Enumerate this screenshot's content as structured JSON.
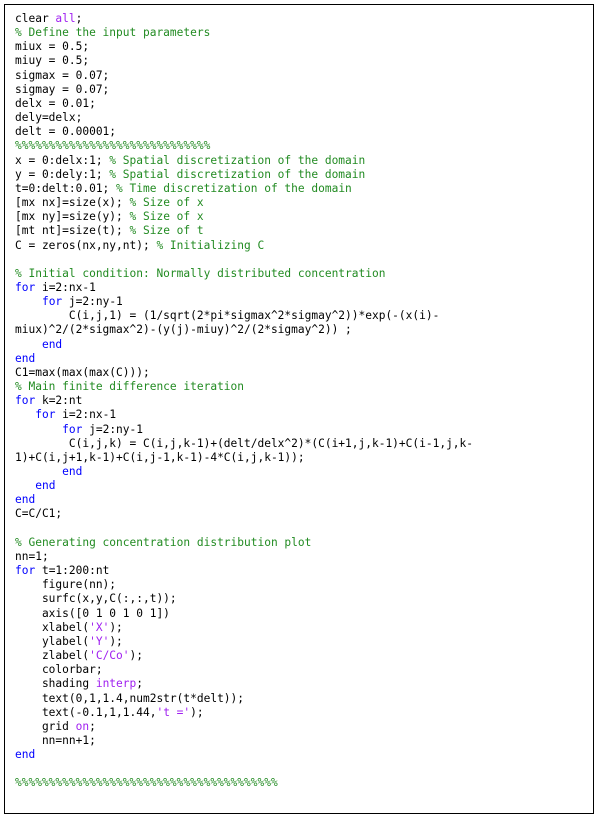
{
  "code": {
    "lines": [
      [
        {
          "t": "pl",
          "v": "clear "
        },
        {
          "t": "str",
          "v": "all"
        },
        {
          "t": "pl",
          "v": ";"
        }
      ],
      [
        {
          "t": "cm",
          "v": "% Define the input parameters"
        }
      ],
      [
        {
          "t": "pl",
          "v": "miux = 0.5;"
        }
      ],
      [
        {
          "t": "pl",
          "v": "miuy = 0.5;"
        }
      ],
      [
        {
          "t": "pl",
          "v": "sigmax = 0.07;"
        }
      ],
      [
        {
          "t": "pl",
          "v": "sigmay = 0.07;"
        }
      ],
      [
        {
          "t": "pl",
          "v": "delx = 0.01;"
        }
      ],
      [
        {
          "t": "pl",
          "v": "dely=delx;"
        }
      ],
      [
        {
          "t": "pl",
          "v": "delt = 0.00001;"
        }
      ],
      [
        {
          "t": "cm",
          "v": "%%%%%%%%%%%%%%%%%%%%%%%%%%%%%"
        }
      ],
      [
        {
          "t": "pl",
          "v": "x = 0:delx:1; "
        },
        {
          "t": "cm",
          "v": "% Spatial discretization of the domain"
        }
      ],
      [
        {
          "t": "pl",
          "v": "y = 0:dely:1; "
        },
        {
          "t": "cm",
          "v": "% Spatial discretization of the domain"
        }
      ],
      [
        {
          "t": "pl",
          "v": "t=0:delt:0.01; "
        },
        {
          "t": "cm",
          "v": "% Time discretization of the domain"
        }
      ],
      [
        {
          "t": "pl",
          "v": "[mx nx]=size(x); "
        },
        {
          "t": "cm",
          "v": "% Size of x"
        }
      ],
      [
        {
          "t": "pl",
          "v": "[mx ny]=size(y); "
        },
        {
          "t": "cm",
          "v": "% Size of x"
        }
      ],
      [
        {
          "t": "pl",
          "v": "[mt nt]=size(t); "
        },
        {
          "t": "cm",
          "v": "% Size of t"
        }
      ],
      [
        {
          "t": "pl",
          "v": "C = zeros(nx,ny,nt); "
        },
        {
          "t": "cm",
          "v": "% Initializing C"
        }
      ],
      [],
      [
        {
          "t": "cm",
          "v": "% Initial condition: Normally distributed concentration"
        }
      ],
      [
        {
          "t": "kw",
          "v": "for"
        },
        {
          "t": "pl",
          "v": " i=2:nx-1"
        }
      ],
      [
        {
          "t": "pl",
          "v": "    "
        },
        {
          "t": "kw",
          "v": "for"
        },
        {
          "t": "pl",
          "v": " j=2:ny-1"
        }
      ],
      [
        {
          "t": "pl",
          "v": "        C(i,j,1) = (1/sqrt(2*pi*sigmax^2*sigmay^2))*exp(-(x(i)-"
        }
      ],
      [
        {
          "t": "pl",
          "v": "miux)^2/(2*sigmax^2)-(y(j)-miuy)^2/(2*sigmay^2)) ;"
        }
      ],
      [
        {
          "t": "pl",
          "v": "    "
        },
        {
          "t": "kw",
          "v": "end"
        }
      ],
      [
        {
          "t": "kw",
          "v": "end"
        }
      ],
      [
        {
          "t": "pl",
          "v": "C1=max(max(max(C)));"
        }
      ],
      [
        {
          "t": "cm",
          "v": "% Main finite difference iteration"
        }
      ],
      [
        {
          "t": "kw",
          "v": "for"
        },
        {
          "t": "pl",
          "v": " k=2:nt"
        }
      ],
      [
        {
          "t": "pl",
          "v": "   "
        },
        {
          "t": "kw",
          "v": "for"
        },
        {
          "t": "pl",
          "v": " i=2:nx-1"
        }
      ],
      [
        {
          "t": "pl",
          "v": "       "
        },
        {
          "t": "kw",
          "v": "for"
        },
        {
          "t": "pl",
          "v": " j=2:ny-1"
        }
      ],
      [
        {
          "t": "pl",
          "v": "        C(i,j,k) = C(i,j,k-1)+(delt/delx^2)*(C(i+1,j,k-1)+C(i-1,j,k-"
        }
      ],
      [
        {
          "t": "pl",
          "v": "1)+C(i,j+1,k-1)+C(i,j-1,k-1)-4*C(i,j,k-1));"
        }
      ],
      [
        {
          "t": "pl",
          "v": "       "
        },
        {
          "t": "kw",
          "v": "end"
        }
      ],
      [
        {
          "t": "pl",
          "v": "   "
        },
        {
          "t": "kw",
          "v": "end"
        }
      ],
      [
        {
          "t": "kw",
          "v": "end"
        }
      ],
      [
        {
          "t": "pl",
          "v": "C=C/C1;"
        }
      ],
      [],
      [
        {
          "t": "cm",
          "v": "% Generating concentration distribution plot"
        }
      ],
      [
        {
          "t": "pl",
          "v": "nn=1;"
        }
      ],
      [
        {
          "t": "kw",
          "v": "for"
        },
        {
          "t": "pl",
          "v": " t=1:200:nt"
        }
      ],
      [
        {
          "t": "pl",
          "v": "    figure(nn);"
        }
      ],
      [
        {
          "t": "pl",
          "v": "    surfc(x,y,C(:,:,t));"
        }
      ],
      [
        {
          "t": "pl",
          "v": "    axis([0 1 0 1 0 1])"
        }
      ],
      [
        {
          "t": "pl",
          "v": "    xlabel("
        },
        {
          "t": "str",
          "v": "'X'"
        },
        {
          "t": "pl",
          "v": ");"
        }
      ],
      [
        {
          "t": "pl",
          "v": "    ylabel("
        },
        {
          "t": "str",
          "v": "'Y'"
        },
        {
          "t": "pl",
          "v": ");"
        }
      ],
      [
        {
          "t": "pl",
          "v": "    zlabel("
        },
        {
          "t": "str",
          "v": "'C/Co'"
        },
        {
          "t": "pl",
          "v": ");"
        }
      ],
      [
        {
          "t": "pl",
          "v": "    colorbar;"
        }
      ],
      [
        {
          "t": "pl",
          "v": "    shading "
        },
        {
          "t": "str",
          "v": "interp"
        },
        {
          "t": "pl",
          "v": ";"
        }
      ],
      [
        {
          "t": "pl",
          "v": "    text(0,1,1.4,num2str(t*delt));"
        }
      ],
      [
        {
          "t": "pl",
          "v": "    text(-0.1,1,1.44,"
        },
        {
          "t": "str",
          "v": "'t ='"
        },
        {
          "t": "pl",
          "v": ");"
        }
      ],
      [
        {
          "t": "pl",
          "v": "    grid "
        },
        {
          "t": "str",
          "v": "on"
        },
        {
          "t": "pl",
          "v": ";"
        }
      ],
      [
        {
          "t": "pl",
          "v": "    nn=nn+1;"
        }
      ],
      [
        {
          "t": "kw",
          "v": "end"
        }
      ],
      [],
      [
        {
          "t": "cm",
          "v": "%%%%%%%%%%%%%%%%%%%%%%%%%%%%%%%%%%%%%%%"
        }
      ]
    ]
  },
  "colors": {
    "keyword": "#0000ff",
    "comment": "#228b22",
    "string": "#a020f0",
    "text": "#000000",
    "border": "#000000",
    "background": "#ffffff"
  }
}
